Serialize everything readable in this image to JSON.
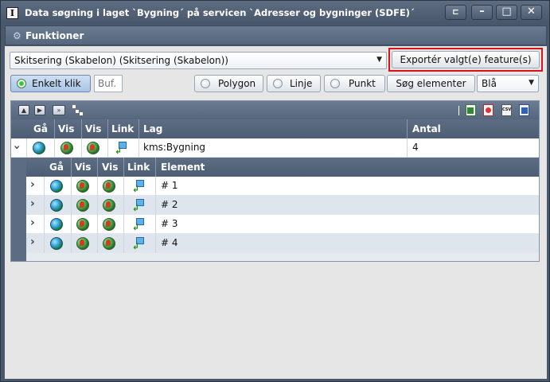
{
  "window": {
    "title": "Data søgning i laget `Bygning´ på servicen `Adresser og bygninger (SDFE)´",
    "app_icon_letter": "I"
  },
  "func_bar": {
    "label": "Funktioner"
  },
  "template_select": {
    "value": "Skitsering (Skabelon) (Skitsering (Skabelon))"
  },
  "export_button": {
    "label": "Exportér valgt(e) feature(s)",
    "highlight_color": "#d8121b"
  },
  "mode": {
    "enkelt_klik": "Enkelt klik",
    "buf_placeholder": "Buf.",
    "polygon": "Polygon",
    "linje": "Linje",
    "punkt": "Punkt",
    "search": "Søg elementer",
    "color_value": "Blå"
  },
  "grid": {
    "toolbar_icons": [
      "collapse-up-icon",
      "next-icon",
      "fast-forward-icon",
      "tree-icon",
      "excel-icon",
      "pdf-icon",
      "csv-icon",
      "word-icon"
    ],
    "csv_text": "CSV",
    "columns": [
      "Gå",
      "Vis",
      "Vis",
      "Link",
      "Lag",
      "Antal"
    ],
    "layer_row": {
      "layer": "kms:Bygning",
      "count": "4"
    },
    "sub_columns": [
      "Gå",
      "Vis",
      "Vis",
      "Link",
      "Element"
    ],
    "elements": [
      "# 1",
      "# 2",
      "# 3",
      "# 4"
    ]
  },
  "colors": {
    "title_bg": "#4a586c",
    "header_bg": "#56667d",
    "row_alt": "#dfe5ec"
  }
}
